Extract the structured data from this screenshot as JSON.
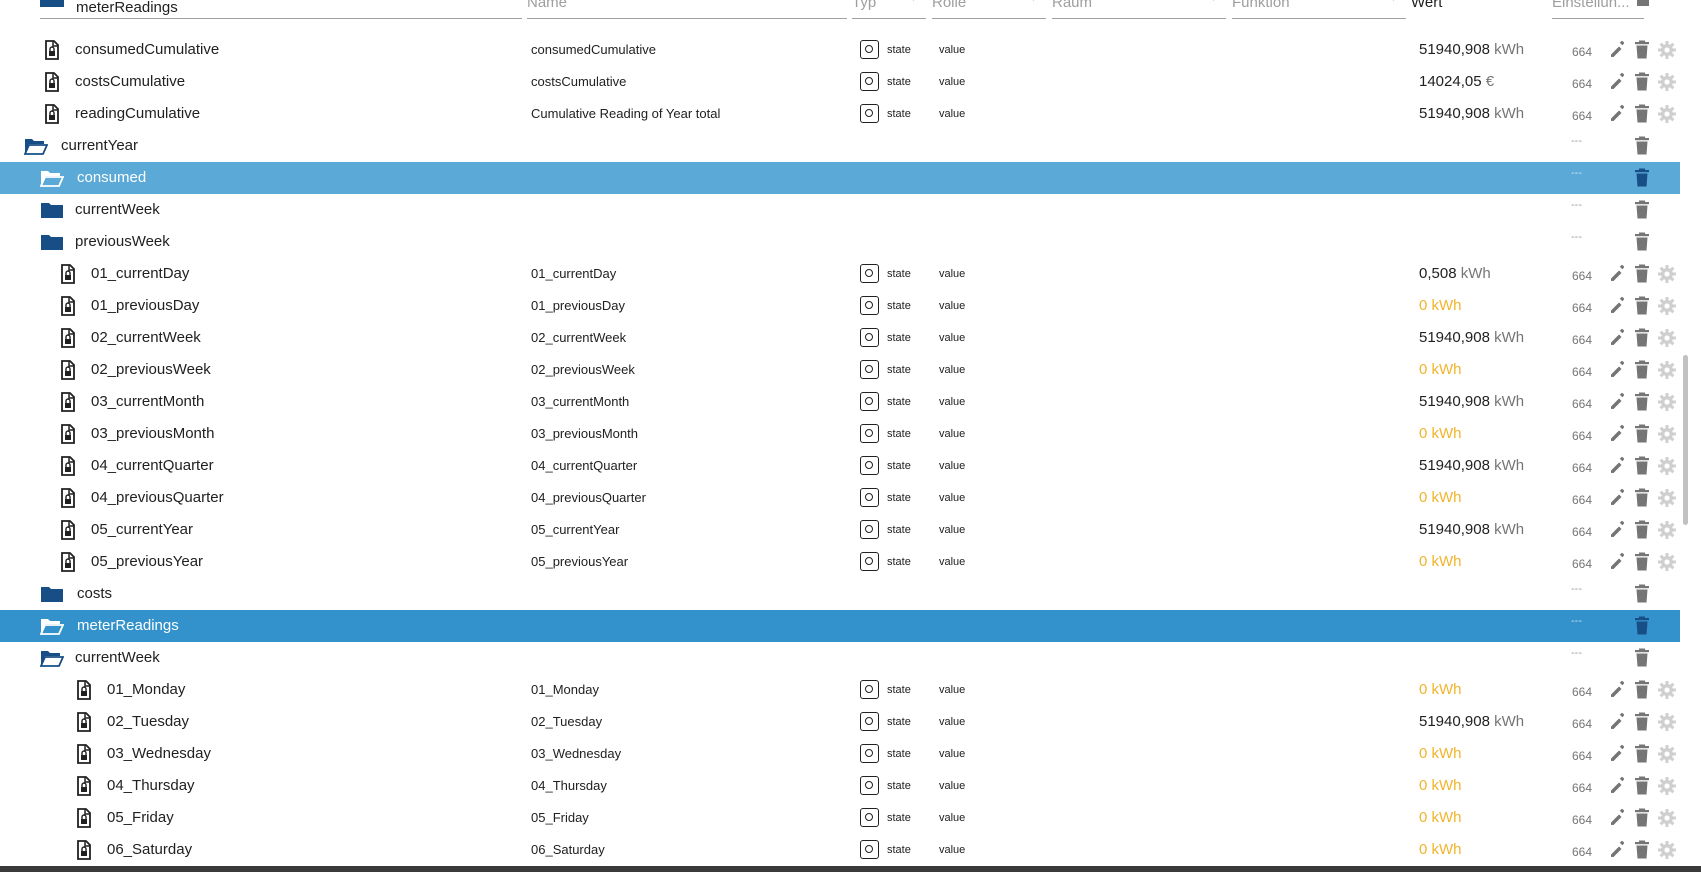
{
  "header": {
    "col_id": "meterReadings",
    "col_name": "Name",
    "col_type": "Typ",
    "col_role": "Rolle",
    "col_room": "Raum",
    "col_function": "Funktion",
    "col_value": "Wert",
    "col_settings": "Einstellun..."
  },
  "rows": [
    {
      "label": "consumedCumulative",
      "name": "consumedCumulative",
      "type": "state",
      "role": "value",
      "value": "51940,908",
      "unit": "kWh",
      "acl": "664"
    },
    {
      "label": "costsCumulative",
      "name": "costsCumulative",
      "type": "state",
      "role": "value",
      "value": "14024,05",
      "unit": "€",
      "acl": "664"
    },
    {
      "label": "readingCumulative",
      "name": "Cumulative Reading of Year total",
      "type": "state",
      "role": "value",
      "value": "51940,908",
      "unit": "kWh",
      "acl": "664"
    },
    {
      "label": "currentYear",
      "dash": "---"
    },
    {
      "label": "consumed",
      "dash": "---"
    },
    {
      "label": "currentWeek",
      "dash": "---"
    },
    {
      "label": "previousWeek",
      "dash": "---"
    },
    {
      "label": "01_currentDay",
      "name": "01_currentDay",
      "type": "state",
      "role": "value",
      "value": "0,508",
      "unit": "kWh",
      "acl": "664"
    },
    {
      "label": "01_previousDay",
      "name": "01_previousDay",
      "type": "state",
      "role": "value",
      "value": "0",
      "unit": "kWh",
      "acl": "664"
    },
    {
      "label": "02_currentWeek",
      "name": "02_currentWeek",
      "type": "state",
      "role": "value",
      "value": "51940,908",
      "unit": "kWh",
      "acl": "664"
    },
    {
      "label": "02_previousWeek",
      "name": "02_previousWeek",
      "type": "state",
      "role": "value",
      "value": "0",
      "unit": "kWh",
      "acl": "664"
    },
    {
      "label": "03_currentMonth",
      "name": "03_currentMonth",
      "type": "state",
      "role": "value",
      "value": "51940,908",
      "unit": "kWh",
      "acl": "664"
    },
    {
      "label": "03_previousMonth",
      "name": "03_previousMonth",
      "type": "state",
      "role": "value",
      "value": "0",
      "unit": "kWh",
      "acl": "664"
    },
    {
      "label": "04_currentQuarter",
      "name": "04_currentQuarter",
      "type": "state",
      "role": "value",
      "value": "51940,908",
      "unit": "kWh",
      "acl": "664"
    },
    {
      "label": "04_previousQuarter",
      "name": "04_previousQuarter",
      "type": "state",
      "role": "value",
      "value": "0",
      "unit": "kWh",
      "acl": "664"
    },
    {
      "label": "05_currentYear",
      "name": "05_currentYear",
      "type": "state",
      "role": "value",
      "value": "51940,908",
      "unit": "kWh",
      "acl": "664"
    },
    {
      "label": "05_previousYear",
      "name": "05_previousYear",
      "type": "state",
      "role": "value",
      "value": "0",
      "unit": "kWh",
      "acl": "664"
    },
    {
      "label": "costs",
      "dash": "---"
    },
    {
      "label": "meterReadings",
      "dash": "---"
    },
    {
      "label": "currentWeek",
      "dash": "---"
    },
    {
      "label": "01_Monday",
      "name": "01_Monday",
      "type": "state",
      "role": "value",
      "value": "0",
      "unit": "kWh",
      "acl": "664"
    },
    {
      "label": "02_Tuesday",
      "name": "02_Tuesday",
      "type": "state",
      "role": "value",
      "value": "51940,908",
      "unit": "kWh",
      "acl": "664"
    },
    {
      "label": "03_Wednesday",
      "name": "03_Wednesday",
      "type": "state",
      "role": "value",
      "value": "0",
      "unit": "kWh",
      "acl": "664"
    },
    {
      "label": "04_Thursday",
      "name": "04_Thursday",
      "type": "state",
      "role": "value",
      "value": "0",
      "unit": "kWh",
      "acl": "664"
    },
    {
      "label": "05_Friday",
      "name": "05_Friday",
      "type": "state",
      "role": "value",
      "value": "0",
      "unit": "kWh",
      "acl": "664"
    },
    {
      "label": "06_Saturday",
      "name": "06_Saturday",
      "type": "state",
      "role": "value",
      "value": "0",
      "unit": "kWh",
      "acl": "664"
    }
  ],
  "colors": {
    "folder": "#174e86",
    "selected_light": "#5aa9d6",
    "selected_dark": "#3392cb",
    "zero_value": "#f0b429",
    "icon_gray": "#757575"
  }
}
